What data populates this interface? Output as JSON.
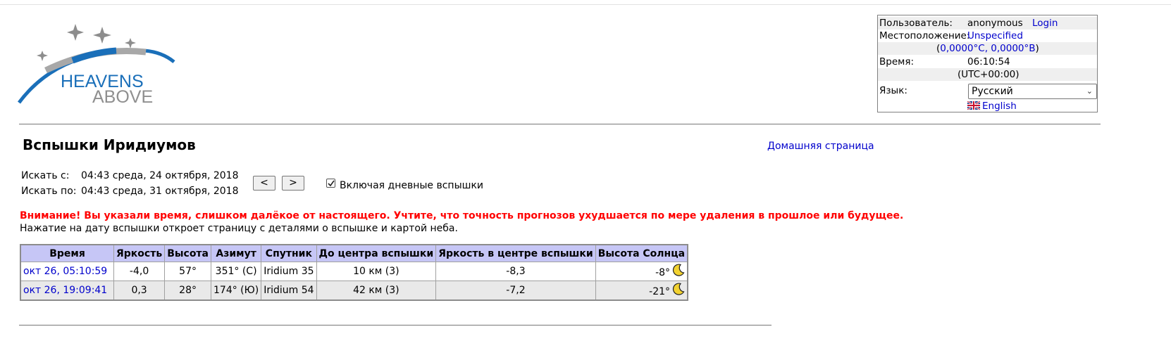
{
  "header": {
    "logo_line1": "HEAVENS",
    "logo_line2": "ABOVE"
  },
  "userbox": {
    "user_label": "Пользователь:",
    "user_value": "anonymous",
    "login_link": "Login",
    "location_label": "Местоположение:",
    "location_value": "Unspecified",
    "coords_open": "(",
    "coords_value": "0,0000°С, 0,0000°В",
    "coords_close": ")",
    "time_label": "Время:",
    "time_value": "06:10:54",
    "timezone": "(UTC+00:00)",
    "language_label": "Язык:",
    "language_selected": "Русский",
    "english_link": "English"
  },
  "page": {
    "title": "Вспышки Иридиумов",
    "home_link": "Домашняя страница",
    "search_from_label": "Искать с:",
    "search_from_value": "04:43 среда, 24 октября, 2018",
    "search_to_label": "Искать по:",
    "search_to_value": "04:43 среда, 31 октября, 2018",
    "prev_button": "<",
    "next_button": ">",
    "daytime_checkbox_label": "Включая дневные вспышки",
    "daytime_checked": true,
    "warning": "Внимание! Вы указали время, слишком далёкое от настоящего. Учтите, что точность прогнозов ухудшается по мере удаления в прошлое или будущее.",
    "note": "Нажатие на дату вспышки откроет страницу с деталями о вспышке и картой неба."
  },
  "table": {
    "headers": [
      "Время",
      "Яркость",
      "Высота",
      "Азимут",
      "Спутник",
      "До центра вспышки",
      "Яркость в центре вспышки",
      "Высота Солнца"
    ],
    "rows": [
      {
        "time": "окт 26, 05:10:59",
        "brightness": "-4,0",
        "altitude": "57°",
        "azimuth": "351° (С)",
        "satellite": "Iridium 35",
        "distance": "10 км (3)",
        "center_brightness": "-8,3",
        "sun_altitude": "-8°",
        "sun_icon": "moon-icon"
      },
      {
        "time": "окт 26, 19:09:41",
        "brightness": "0,3",
        "altitude": "28°",
        "azimuth": "174° (Ю)",
        "satellite": "Iridium 54",
        "distance": "42 км (3)",
        "center_brightness": "-7,2",
        "sun_altitude": "-21°",
        "sun_icon": "moon-icon"
      }
    ]
  },
  "colors": {
    "link": "#0000cc",
    "warning": "#ff0000",
    "table_header_bg": "#c6c6f6",
    "logo_blue": "#1a6fb9",
    "logo_gray": "#9a9a9a"
  }
}
